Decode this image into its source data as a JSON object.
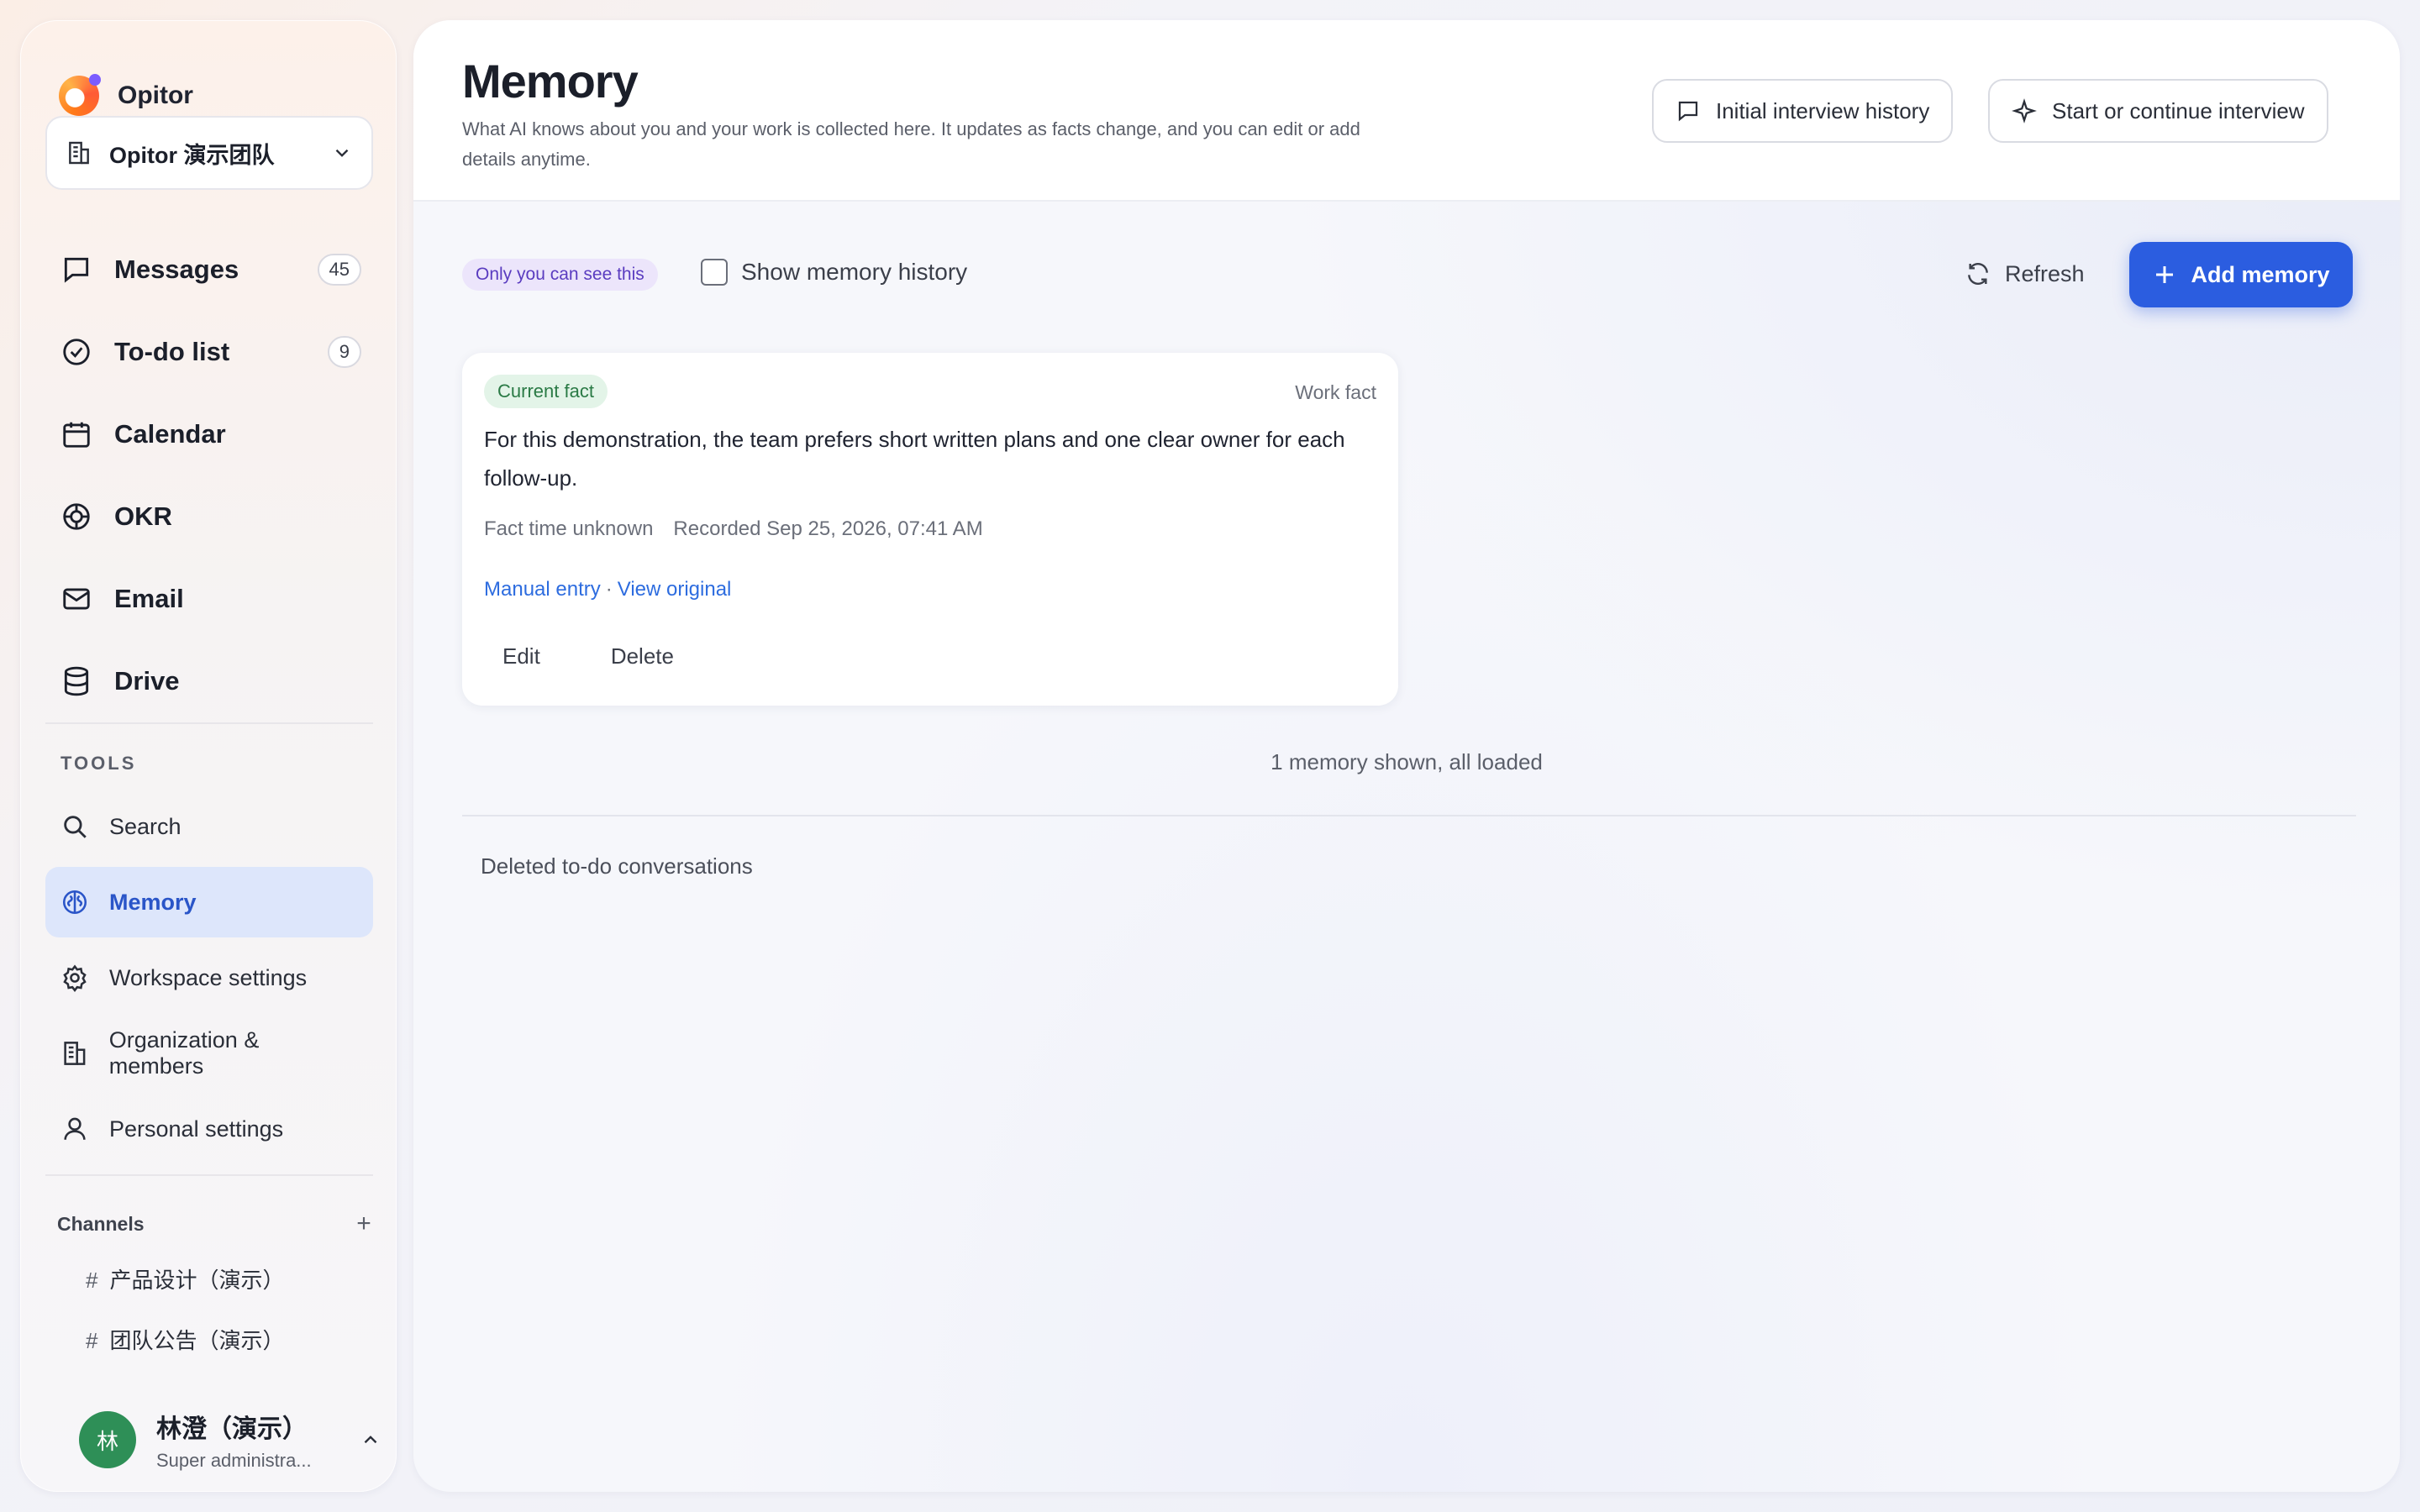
{
  "brand": {
    "name": "Opitor"
  },
  "team": {
    "name": "Opitor 演示团队"
  },
  "nav": [
    {
      "label": "Messages",
      "badge": "45"
    },
    {
      "label": "To-do list",
      "badge": "9"
    },
    {
      "label": "Calendar"
    },
    {
      "label": "OKR"
    },
    {
      "label": "Email"
    },
    {
      "label": "Drive"
    }
  ],
  "tools": {
    "title": "TOOLS",
    "items": [
      {
        "label": "Search"
      },
      {
        "label": "Memory"
      },
      {
        "label": "Workspace settings"
      },
      {
        "label": "Organization & members"
      },
      {
        "label": "Personal settings"
      }
    ]
  },
  "channels": {
    "title": "Channels",
    "add": "+",
    "items": [
      {
        "hash": "#",
        "label": "产品设计（演示）"
      },
      {
        "hash": "#",
        "label": "团队公告（演示）"
      }
    ]
  },
  "user": {
    "initial": "林",
    "name": "林澄（演示）",
    "role": "Super administra..."
  },
  "header": {
    "title": "Memory",
    "description": "What AI knows about you and your work is collected here. It updates as facts change, and you can edit or add details anytime.",
    "history_button": "Initial interview history",
    "interview_button": "Start or continue interview"
  },
  "toolbar": {
    "privacy": "Only you can see this",
    "show_history": "Show memory history",
    "refresh": "Refresh",
    "add": "Add memory"
  },
  "memory": {
    "status": "Current fact",
    "type": "Work fact",
    "text": "For this demonstration, the team prefers short written plans and one clear owner for each follow-up.",
    "fact_time": "Fact time unknown",
    "recorded": "Recorded Sep 25, 2026, 07:41 AM",
    "source": "Manual entry",
    "separator": "·",
    "view_original": "View original",
    "edit": "Edit",
    "delete": "Delete"
  },
  "summary": "1 memory shown, all loaded",
  "deleted_section": "Deleted to-do conversations",
  "colors": {
    "accent": "#2b5de0",
    "active_bg": "#dde6fb",
    "fact_green": "#2a7a45",
    "privacy_purple": "#5a3cc0",
    "avatar": "#2e8f57"
  }
}
